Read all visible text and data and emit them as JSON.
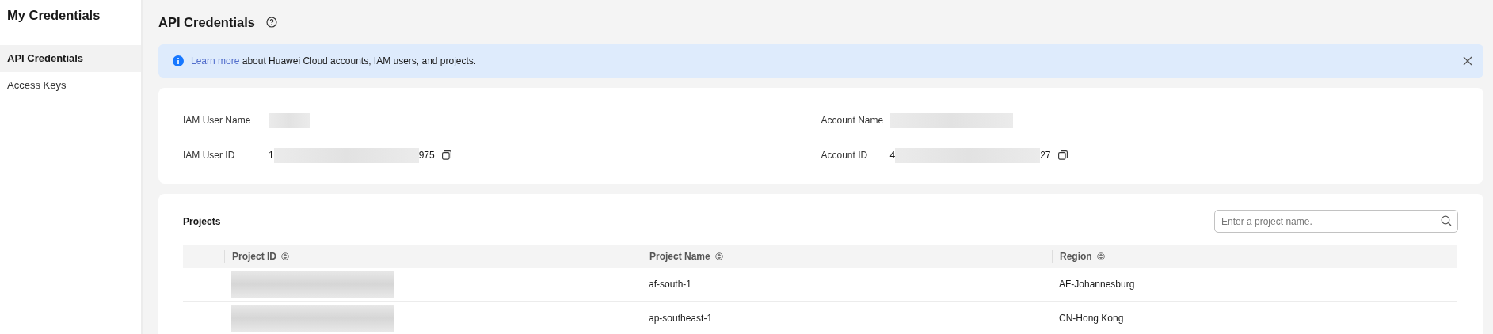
{
  "sidebar": {
    "title": "My Credentials",
    "items": [
      {
        "label": "API Credentials",
        "selected": true
      },
      {
        "label": "Access Keys",
        "selected": false
      }
    ]
  },
  "page": {
    "title": "API Credentials"
  },
  "notice": {
    "link": "Learn more",
    "text": " about Huawei Cloud accounts, IAM users, and projects."
  },
  "details": [
    {
      "label": "IAM User Name",
      "redacted": true,
      "copyable": false
    },
    {
      "label": "Account Name",
      "redacted": true,
      "copyable": false
    },
    {
      "label": "IAM User ID",
      "prefix": "1",
      "suffix": "975",
      "redacted": true,
      "copyable": true
    },
    {
      "label": "Account ID",
      "prefix": "4",
      "suffix": "27",
      "redacted": true,
      "copyable": true
    }
  ],
  "projects": {
    "title": "Projects",
    "search": {
      "placeholder": "Enter a project name."
    },
    "columns": [
      "Project ID",
      "Project Name",
      "Region"
    ],
    "rows": [
      {
        "project_id_redacted": true,
        "name": "af-south-1",
        "region": "AF-Johannesburg"
      },
      {
        "project_id_redacted": true,
        "name": "ap-southeast-1",
        "region": "CN-Hong Kong"
      }
    ]
  }
}
